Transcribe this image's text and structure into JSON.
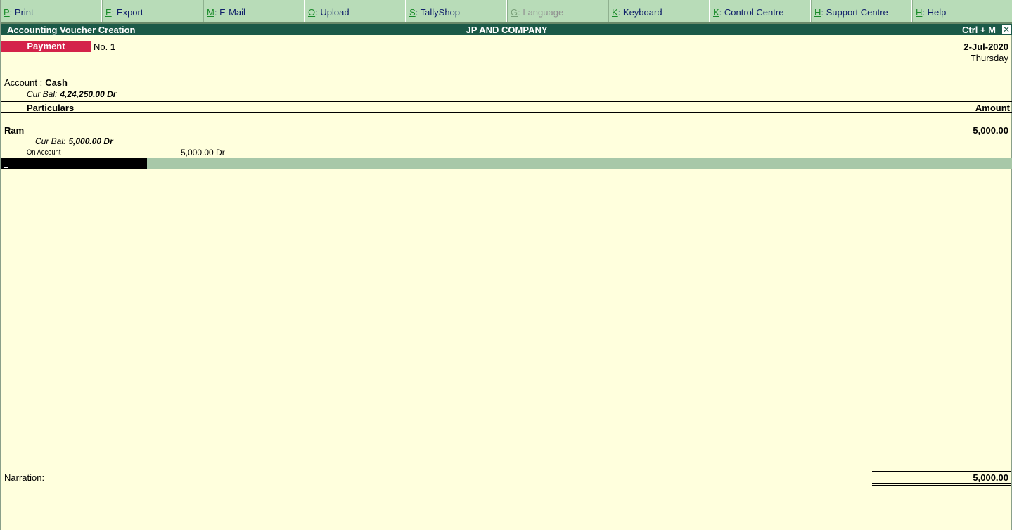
{
  "menu": [
    {
      "key": "P",
      "label": ": Print",
      "enabled": true
    },
    {
      "key": "E",
      "label": ": Export",
      "enabled": true
    },
    {
      "key": "M",
      "label": ": E-Mail",
      "enabled": true
    },
    {
      "key": "O",
      "label": ": Upload",
      "enabled": true
    },
    {
      "key": "S",
      "label": ": TallyShop",
      "enabled": true
    },
    {
      "key": "G",
      "label": ": Language",
      "enabled": false
    },
    {
      "key": "K",
      "label": ": Keyboard",
      "enabled": true
    },
    {
      "key": "K",
      "label": ": Control Centre",
      "enabled": true
    },
    {
      "key": "H",
      "label": ": Support Centre",
      "enabled": true
    },
    {
      "key": "H",
      "label": ": Help",
      "enabled": true
    }
  ],
  "titlebar": {
    "left": "Accounting Voucher  Creation",
    "center": "JP AND COMPANY",
    "right": "Ctrl + M",
    "close": "✕"
  },
  "voucher": {
    "type": "Payment",
    "no_label": "No.",
    "no": "1",
    "date": "2-Jul-2020",
    "day": "Thursday"
  },
  "account": {
    "label": "Account :",
    "name": "Cash",
    "bal_label": "Cur Bal:",
    "bal": "4,24,250.00 Dr"
  },
  "columns": {
    "particulars": "Particulars",
    "amount": "Amount"
  },
  "entry": {
    "ledger": "Ram",
    "amount": "5,000.00",
    "bal_label": "Cur Bal:",
    "bal": "5,000.00 Dr",
    "bill_type": "On Account",
    "bill_amount": "5,000.00  Dr"
  },
  "footer": {
    "narration_label": "Narration:",
    "total": "5,000.00"
  },
  "colors": {
    "background": "#ffffdd",
    "menubar": "#b8dcb8",
    "titlebar": "#1b5a48",
    "voucher_type": "#d4234a",
    "hotkey": "#1a8a2a"
  }
}
